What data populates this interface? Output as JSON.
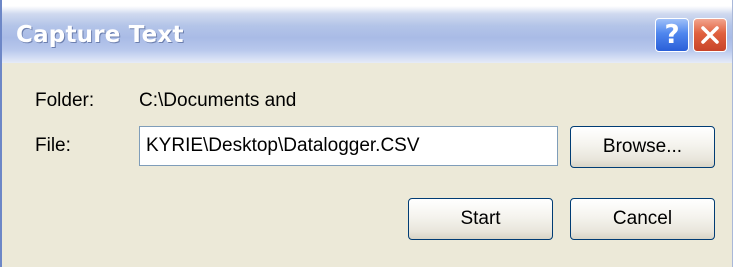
{
  "window": {
    "title": "Capture Text",
    "help_glyph": "?",
    "help_icon": "help-icon",
    "close_icon": "close-icon"
  },
  "form": {
    "folder_label": "Folder:",
    "folder_value": "C:\\Documents and",
    "file_label": "File:",
    "file_value": "KYRIE\\Desktop\\Datalogger.CSV"
  },
  "buttons": {
    "browse_label": "Browse...",
    "start_label": "Start",
    "cancel_label": "Cancel"
  },
  "colors": {
    "title_bar": "#b3c4e8",
    "dialog_face": "#ece9d8",
    "help_button": "#2a5fd8",
    "close_button": "#e0603e",
    "input_border": "#7f9db9"
  }
}
